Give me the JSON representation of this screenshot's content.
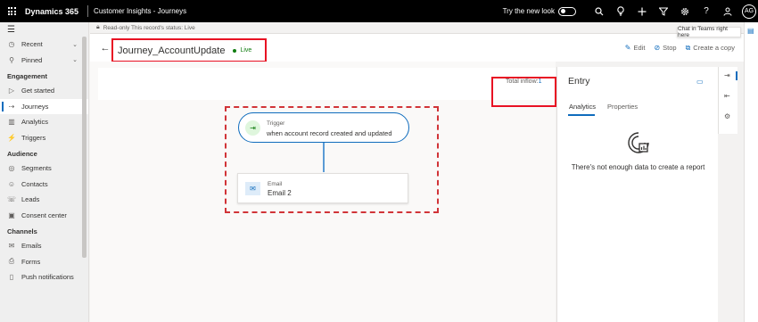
{
  "topbar": {
    "brand": "Dynamics 365",
    "app_name": "Customer Insights - Journeys",
    "try_new_look": "Try the new look",
    "avatar_initials": "AG"
  },
  "notification": {
    "text": "Read-only This record's status: Live"
  },
  "sidebar": {
    "items_top": [
      {
        "label": "Recent",
        "icon": "clock-icon"
      },
      {
        "label": "Pinned",
        "icon": "pin-icon"
      }
    ],
    "sections": [
      {
        "title": "Engagement",
        "items": [
          {
            "label": "Get started",
            "icon": "play-icon"
          },
          {
            "label": "Journeys",
            "icon": "journey-icon",
            "active": true
          },
          {
            "label": "Analytics",
            "icon": "chart-icon"
          },
          {
            "label": "Triggers",
            "icon": "trigger-icon"
          }
        ]
      },
      {
        "title": "Audience",
        "items": [
          {
            "label": "Segments",
            "icon": "segments-icon"
          },
          {
            "label": "Contacts",
            "icon": "contacts-icon"
          },
          {
            "label": "Leads",
            "icon": "leads-icon"
          },
          {
            "label": "Consent center",
            "icon": "consent-icon"
          }
        ]
      },
      {
        "title": "Channels",
        "items": [
          {
            "label": "Emails",
            "icon": "mail-icon"
          },
          {
            "label": "Forms",
            "icon": "forms-icon"
          },
          {
            "label": "Push notifications",
            "icon": "push-icon"
          }
        ]
      }
    ]
  },
  "header": {
    "title": "Journey_AccountUpdate",
    "status": "Live",
    "actions": {
      "edit": "Edit",
      "stop": "Stop",
      "copy": "Create a copy"
    }
  },
  "canvas": {
    "inflow_label": "Total inflow:",
    "inflow_value": "1",
    "trigger": {
      "label": "Trigger",
      "text": "when account record created and updated"
    },
    "email": {
      "label": "Email",
      "text": "Email 2"
    }
  },
  "panel": {
    "title": "Entry",
    "tabs": [
      "Analytics",
      "Properties"
    ],
    "empty_message": "There's not enough data to create a report"
  },
  "tooltip": "Chat in Teams right here",
  "colors": {
    "accent": "#0f6cbd",
    "live": "#107c10",
    "highlight": "#e81123"
  }
}
